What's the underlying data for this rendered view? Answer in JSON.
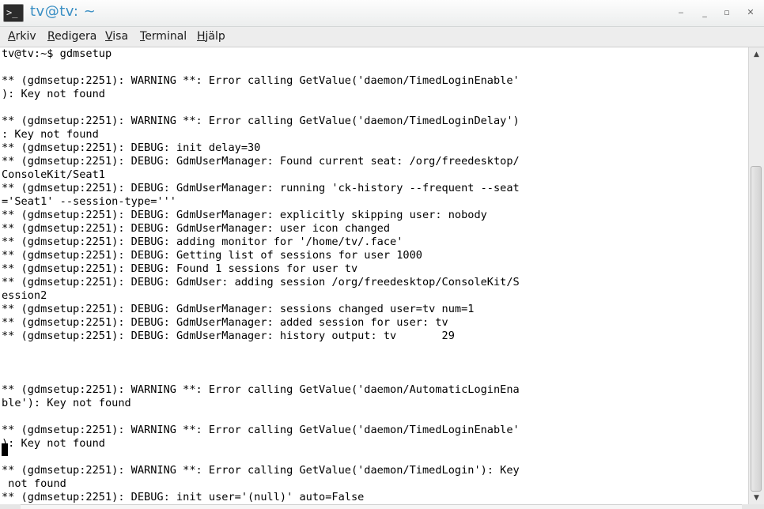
{
  "window": {
    "title": "tv@tv: ~",
    "app_icon_glyph": ">_",
    "controls": {
      "minimize_glyph": "‒",
      "shade_glyph": "_",
      "maximize_glyph": "▫",
      "close_glyph": "✕"
    }
  },
  "menubar": {
    "items": [
      {
        "mnemonic": "A",
        "rest": "rkiv"
      },
      {
        "mnemonic": "R",
        "rest": "edigera"
      },
      {
        "mnemonic": "V",
        "rest": "isa"
      },
      {
        "mnemonic": "T",
        "rest": "erminal"
      },
      {
        "mnemonic": "H",
        "rest": "jälp"
      }
    ]
  },
  "terminal": {
    "lines": [
      "tv@tv:~$ gdmsetup",
      "",
      "** (gdmsetup:2251): WARNING **: Error calling GetValue('daemon/TimedLoginEnable'",
      "): Key not found",
      "",
      "** (gdmsetup:2251): WARNING **: Error calling GetValue('daemon/TimedLoginDelay')",
      ": Key not found",
      "** (gdmsetup:2251): DEBUG: init delay=30",
      "** (gdmsetup:2251): DEBUG: GdmUserManager: Found current seat: /org/freedesktop/",
      "ConsoleKit/Seat1",
      "** (gdmsetup:2251): DEBUG: GdmUserManager: running 'ck-history --frequent --seat",
      "='Seat1' --session-type='''",
      "** (gdmsetup:2251): DEBUG: GdmUserManager: explicitly skipping user: nobody",
      "** (gdmsetup:2251): DEBUG: GdmUserManager: user icon changed",
      "** (gdmsetup:2251): DEBUG: adding monitor for '/home/tv/.face'",
      "** (gdmsetup:2251): DEBUG: Getting list of sessions for user 1000",
      "** (gdmsetup:2251): DEBUG: Found 1 sessions for user tv",
      "** (gdmsetup:2251): DEBUG: GdmUser: adding session /org/freedesktop/ConsoleKit/S",
      "ession2",
      "** (gdmsetup:2251): DEBUG: GdmUserManager: sessions changed user=tv num=1",
      "** (gdmsetup:2251): DEBUG: GdmUserManager: added session for user: tv",
      "** (gdmsetup:2251): DEBUG: GdmUserManager: history output: tv       29",
      "",
      "",
      "",
      "** (gdmsetup:2251): WARNING **: Error calling GetValue('daemon/AutomaticLoginEna",
      "ble'): Key not found",
      "",
      "** (gdmsetup:2251): WARNING **: Error calling GetValue('daemon/TimedLoginEnable'",
      "): Key not found",
      "",
      "** (gdmsetup:2251): WARNING **: Error calling GetValue('daemon/TimedLogin'): Key",
      " not found",
      "** (gdmsetup:2251): DEBUG: init user='(null)' auto=False"
    ]
  },
  "scrollbar": {
    "up_glyph": "▲",
    "down_glyph": "▼"
  }
}
